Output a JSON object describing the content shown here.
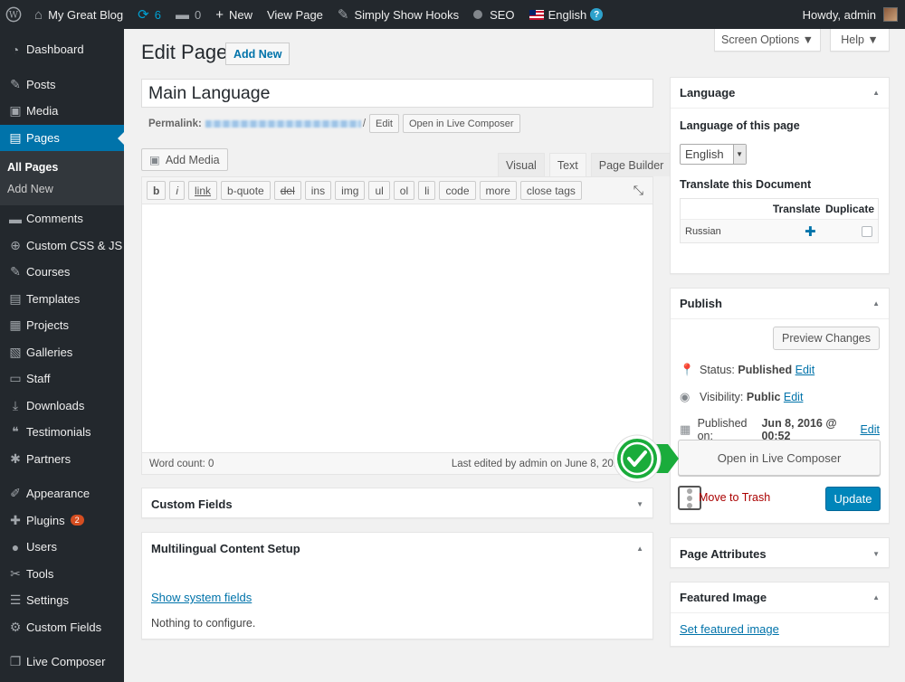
{
  "adminbar": {
    "site_name": "My Great Blog",
    "updates_count": "6",
    "comments_count": "0",
    "new_label": "New",
    "view_page": "View Page",
    "show_hooks": "Simply Show Hooks",
    "seo": "SEO",
    "language": "English",
    "help_mark": "?",
    "howdy": "Howdy, admin"
  },
  "screen_tabs": {
    "screen_options": "Screen Options ▼",
    "help": "Help ▼"
  },
  "sidebar": {
    "items": [
      {
        "label": "Dashboard",
        "icon": "dashboard-icon",
        "glyph": "◔"
      },
      {
        "label": "Posts",
        "icon": "pin-icon",
        "glyph": "✎"
      },
      {
        "label": "Media",
        "icon": "media-icon",
        "glyph": "▣"
      },
      {
        "label": "Pages",
        "icon": "pages-icon",
        "glyph": "▤"
      },
      {
        "label": "Comments",
        "icon": "comments-icon",
        "glyph": "▬"
      },
      {
        "label": "Custom CSS & JS",
        "icon": "plus-circle-icon",
        "glyph": "⊕"
      },
      {
        "label": "Courses",
        "icon": "pin-icon",
        "glyph": "✎"
      },
      {
        "label": "Templates",
        "icon": "pages-icon",
        "glyph": "▤"
      },
      {
        "label": "Projects",
        "icon": "projects-icon",
        "glyph": "▦"
      },
      {
        "label": "Galleries",
        "icon": "gallery-icon",
        "glyph": "▧"
      },
      {
        "label": "Staff",
        "icon": "staff-icon",
        "glyph": "▭"
      },
      {
        "label": "Downloads",
        "icon": "download-icon",
        "glyph": "⤓"
      },
      {
        "label": "Testimonials",
        "icon": "quote-icon",
        "glyph": "❝"
      },
      {
        "label": "Partners",
        "icon": "partners-icon",
        "glyph": "✱"
      },
      {
        "label": "Appearance",
        "icon": "brush-icon",
        "glyph": "✐"
      },
      {
        "label": "Plugins",
        "icon": "plugin-icon",
        "glyph": "✚",
        "badge": "2"
      },
      {
        "label": "Users",
        "icon": "user-icon",
        "glyph": "●"
      },
      {
        "label": "Tools",
        "icon": "wrench-icon",
        "glyph": "✂"
      },
      {
        "label": "Settings",
        "icon": "settings-icon",
        "glyph": "☰"
      },
      {
        "label": "Custom Fields",
        "icon": "gear-icon",
        "glyph": "⚙"
      },
      {
        "label": "Live Composer",
        "icon": "composer-icon",
        "glyph": "❐"
      }
    ],
    "submenu": [
      "All Pages",
      "Add New"
    ]
  },
  "page": {
    "title": "Edit Page",
    "add_new": "Add New",
    "post_title": "Main Language",
    "permalink_label": "Permalink:",
    "permalink_edit": "Edit",
    "open_live_composer_small": "Open in Live Composer",
    "add_media": "Add Media",
    "editor_tabs": [
      "Visual",
      "Text",
      "Page Builder"
    ],
    "quicktags": [
      "b",
      "i",
      "link",
      "b-quote",
      "del",
      "ins",
      "img",
      "ul",
      "ol",
      "li",
      "code",
      "more",
      "close tags"
    ],
    "word_count": "Word count: 0",
    "last_edited": "Last edited by admin on June 8, 2016 at 1"
  },
  "custom_fields": {
    "title": "Custom Fields"
  },
  "multilingual": {
    "title": "Multilingual Content Setup",
    "show_system": "Show system fields",
    "nothing": "Nothing to configure."
  },
  "language_box": {
    "title": "Language",
    "lang_of_page": "Language of this page",
    "selected": "English",
    "translate_doc": "Translate this Document",
    "col_translate": "Translate",
    "col_duplicate": "Duplicate",
    "row_lang": "Russian"
  },
  "publish": {
    "title": "Publish",
    "preview": "Preview Changes",
    "status_label": "Status:",
    "status_value": "Published",
    "visibility_label": "Visibility:",
    "visibility_value": "Public",
    "published_label": "Published on:",
    "published_value": "Jun 8, 2016 @ 00:52",
    "edit": "Edit",
    "open_live_composer": "Open in Live Composer",
    "trash": "Move to Trash",
    "update": "Update"
  },
  "page_attributes": {
    "title": "Page Attributes"
  },
  "featured_image": {
    "title": "Featured Image",
    "link": "Set featured image"
  },
  "colors": {
    "accent": "#0073aa",
    "primary_button": "#0085ba",
    "callout": "#1aac3b",
    "trash": "#a00"
  }
}
